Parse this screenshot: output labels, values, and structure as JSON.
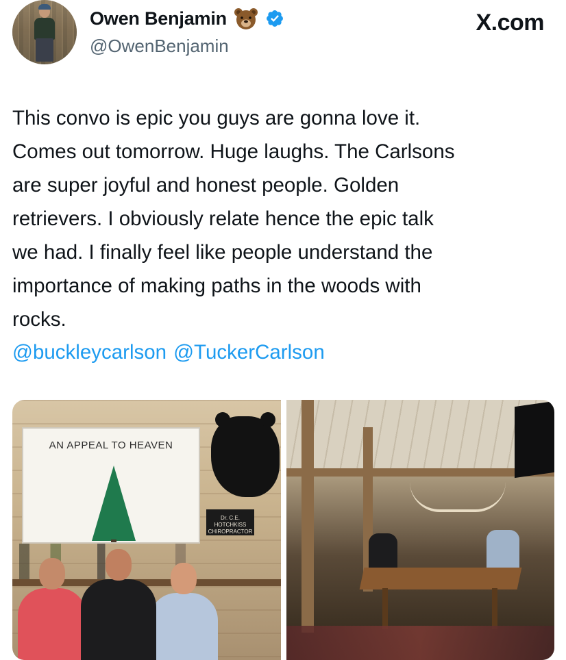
{
  "header": {
    "display_name": "Owen Benjamin",
    "name_emoji": "bear-face-icon",
    "verified": true,
    "verified_color": "#1d9bf0",
    "handle": "@OwenBenjamin",
    "site_label": "X.com"
  },
  "tweet": {
    "text": "This convo is epic you guys are gonna love it.\nComes out tomorrow. Huge laughs. The Carlsons\nare super joyful and honest people. Golden\nretrievers. I obviously relate hence the epic talk\nwe had. I finally feel like people understand the\nimportance of making paths in the woods with\nrocks.",
    "mentions": [
      "@buckleycarlson",
      "@TuckerCarlson"
    ],
    "link_color": "#1d9bf0"
  },
  "photos": {
    "left": {
      "flag_text": "AN APPEAL TO HEAVEN",
      "sign_text": "Dr. C.E. HOTCHKISS CHIROPRACTOR"
    },
    "right": {}
  }
}
